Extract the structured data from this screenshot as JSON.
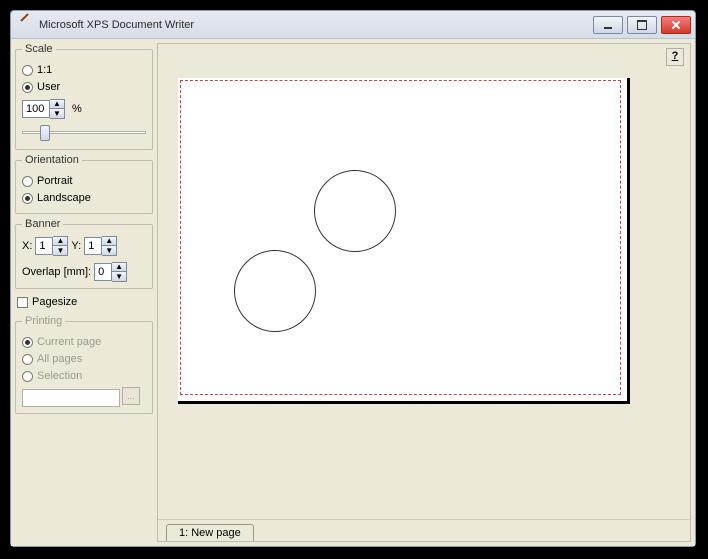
{
  "window": {
    "title": "Microsoft XPS Document Writer"
  },
  "scale": {
    "legend": "Scale",
    "opt_one_to_one": "1:1",
    "opt_user": "User",
    "value": "100",
    "pct": "%"
  },
  "orientation": {
    "legend": "Orientation",
    "opt_portrait": "Portrait",
    "opt_landscape": "Landscape"
  },
  "banner": {
    "legend": "Banner",
    "x_label": "X:",
    "x_value": "1",
    "y_label": "Y:",
    "y_value": "1",
    "overlap_label": "Overlap [mm]:",
    "overlap_value": "0"
  },
  "pagesize": {
    "label": "Pagesize"
  },
  "printing": {
    "legend": "Printing",
    "opt_current": "Current page",
    "opt_all": "All pages",
    "opt_selection": "Selection",
    "browse": "..."
  },
  "help": {
    "label": "?"
  },
  "tab": {
    "label": "1: New page"
  }
}
